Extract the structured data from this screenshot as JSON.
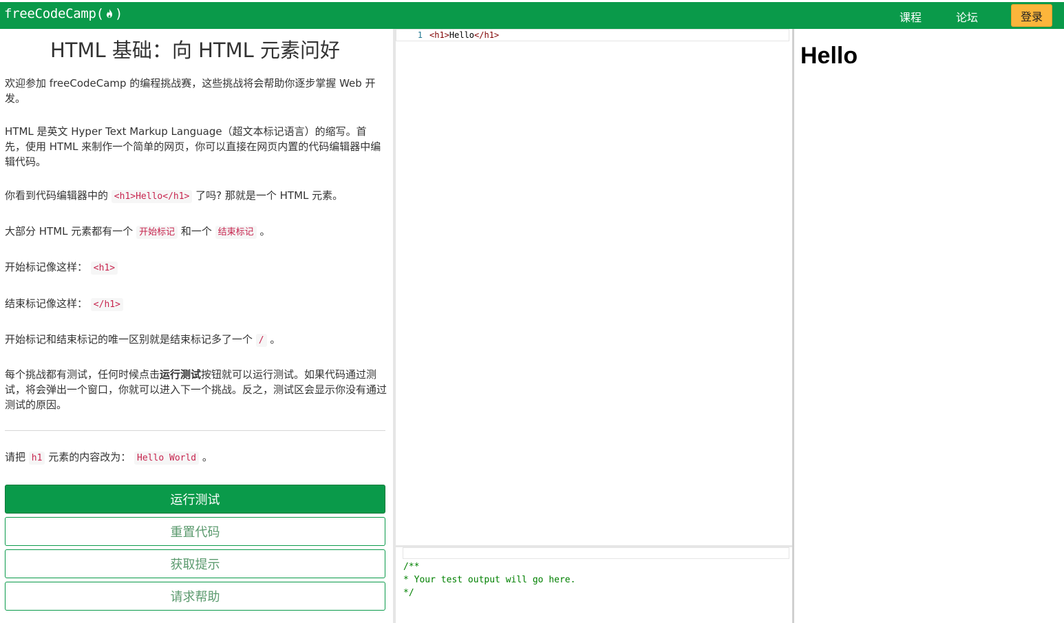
{
  "nav": {
    "brand": "freeCodeCamp(",
    "brand_close": ")",
    "courses": "课程",
    "forum": "论坛",
    "login": "登录"
  },
  "challenge": {
    "title": "HTML 基础：向 HTML 元素问好",
    "p1": "欢迎参加 freeCodeCamp 的编程挑战赛，这些挑战将会帮助你逐步掌握 Web 开发。",
    "p2": "HTML 是英文 Hyper Text Markup Language（超文本标记语言）的缩写。首先，使用 HTML 来制作一个简单的网页，你可以直接在网页内置的代码编辑器中编辑代码。",
    "p3_before": "你看到代码编辑器中的",
    "p3_code": "<h1>Hello</h1>",
    "p3_after": "了吗? 那就是一个 HTML 元素。",
    "p4_before": "大部分 HTML 元素都有一个",
    "p4_code1": "开始标记",
    "p4_mid": "和一个",
    "p4_code2": "结束标记",
    "p4_after": "。",
    "p5_before": "开始标记像这样：",
    "p5_code": "<h1>",
    "p6_before": "结束标记像这样：",
    "p6_code": "</h1>",
    "p7_before": "开始标记和结束标记的唯一区别就是结束标记多了一个",
    "p7_code": "/",
    "p7_after": "。",
    "p8_before": "每个挑战都有测试，任何时候点击",
    "p8_bold": "运行测试",
    "p8_after": "按钮就可以运行测试。如果代码通过测试，将会弹出一个窗口，你就可以进入下一个挑战。反之，测试区会显示你没有通过测试的原因。",
    "task_before": "请把",
    "task_code1": "h1",
    "task_mid": "元素的内容改为：",
    "task_code2": "Hello World",
    "task_after": "。"
  },
  "buttons": {
    "run": "运行测试",
    "reset": "重置代码",
    "hint": "获取提示",
    "help": "请求帮助"
  },
  "editor": {
    "line_number": "1",
    "open_tag": "<h1>",
    "content": "Hello",
    "close_tag": "</h1>"
  },
  "output": {
    "text": "/**\n* Your test output will go here.\n*/"
  },
  "preview": {
    "heading": "Hello"
  },
  "colors": {
    "brand_green": "#0a9a4a",
    "login_yellow": "#fcb53b",
    "code_red": "#c7254e",
    "output_green": "#008000"
  }
}
